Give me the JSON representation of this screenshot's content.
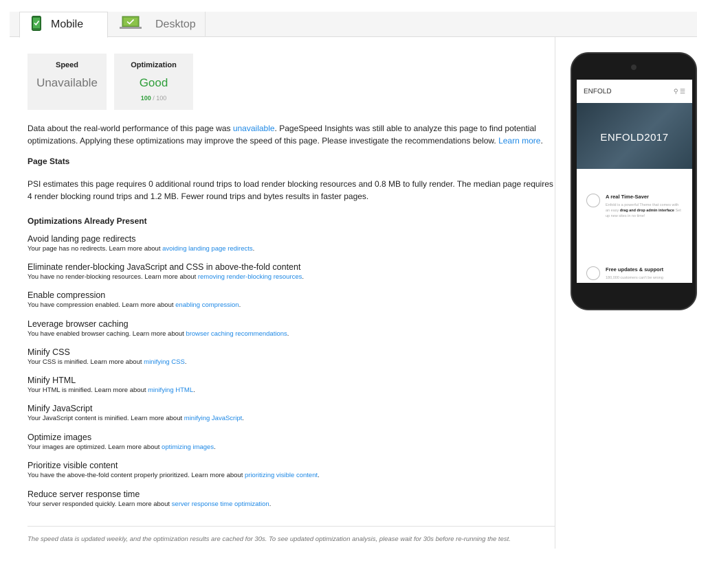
{
  "tabs": {
    "mobile": "Mobile",
    "desktop": "Desktop"
  },
  "scores": {
    "speed_label": "Speed",
    "speed_value": "Unavailable",
    "optimization_label": "Optimization",
    "optimization_value": "Good",
    "optimization_score": "100",
    "optimization_max": "/ 100"
  },
  "intro": {
    "part1": "Data about the real-world performance of this page was ",
    "link1": "unavailable",
    "part2": ". PageSpeed Insights was still able to analyze this page to find potential optimizations. Applying these optimizations may improve the speed of this page. Please investigate the recommendations below. ",
    "link2": "Learn more",
    "part3": "."
  },
  "page_stats": {
    "heading": "Page Stats",
    "text": "PSI estimates this page requires 0 additional round trips to load render blocking resources and 0.8 MB to fully render. The median page requires 4 render blocking round trips and 1.2 MB. Fewer round trips and bytes results in faster pages."
  },
  "optimizations": {
    "heading": "Optimizations Already Present",
    "items": [
      {
        "title": "Avoid landing page redirects",
        "desc": "Your page has no redirects. Learn more about ",
        "link": "avoiding landing page redirects"
      },
      {
        "title": "Eliminate render-blocking JavaScript and CSS in above-the-fold content",
        "desc": "You have no render-blocking resources. Learn more about ",
        "link": "removing render-blocking resources"
      },
      {
        "title": "Enable compression",
        "desc": "You have compression enabled. Learn more about ",
        "link": "enabling compression"
      },
      {
        "title": "Leverage browser caching",
        "desc": "You have enabled browser caching. Learn more about ",
        "link": "browser caching recommendations"
      },
      {
        "title": "Minify CSS",
        "desc": "Your CSS is minified. Learn more about ",
        "link": "minifying CSS"
      },
      {
        "title": "Minify HTML",
        "desc": "Your HTML is minified. Learn more about ",
        "link": "minifying HTML"
      },
      {
        "title": "Minify JavaScript",
        "desc": "Your JavaScript content is minified. Learn more about ",
        "link": "minifying JavaScript"
      },
      {
        "title": "Optimize images",
        "desc": "Your images are optimized. Learn more about ",
        "link": "optimizing images"
      },
      {
        "title": "Prioritize visible content",
        "desc": "You have the above-the-fold content properly prioritized. Learn more about ",
        "link": "prioritizing visible content"
      },
      {
        "title": "Reduce server response time",
        "desc": "Your server responded quickly. Learn more about ",
        "link": "server response time optimization"
      }
    ]
  },
  "footer": "The speed data is updated weekly, and the optimization results are cached for 30s. To see updated optimization analysis, please wait for 30s before re-running the test.",
  "preview": {
    "logo": "ENFOLD",
    "hero": "ENFOLD2017",
    "feature1_title": "A real Time-Saver",
    "feature1_desc_a": "Enfold is a powerful Theme that comes with an easy ",
    "feature1_desc_b": "drag and drop admin interface",
    "feature1_desc_c": " Set up new sites in no time!",
    "feature2_title": "Free updates & support",
    "feature2_desc": "180,000 customers can't be wrong"
  },
  "colors": {
    "good": "#2e9e3a",
    "link": "#1e88e5"
  },
  "icons": {
    "mobile": "phone-check-icon",
    "desktop": "laptop-check-icon"
  }
}
